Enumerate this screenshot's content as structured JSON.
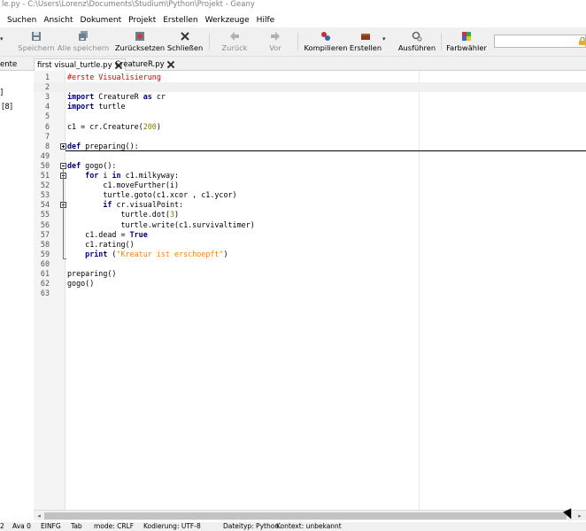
{
  "window": {
    "title": "le.py - C:\\Users\\Lorenz\\Documents\\Studium\\Python\\Projekt - Geany"
  },
  "menu": [
    "Suchen",
    "Ansicht",
    "Dokument",
    "Projekt",
    "Erstellen",
    "Werkzeuge",
    "Hilfe"
  ],
  "toolbar": {
    "save_label": "Speichern",
    "save_all_label": "Alle speichern",
    "revert_label": "Zurücksetzen",
    "close_label": "Schließen",
    "back_label": "Zurück",
    "forward_label": "Vor",
    "compile_label": "Kompilieren",
    "build_label": "Erstellen",
    "run_label": "Ausführen",
    "color_label": "Farbwähler",
    "dropdown_glyph": "▾"
  },
  "sidebar": {
    "tab_label": "ente",
    "items": [
      "]",
      "[8]"
    ]
  },
  "tabs": [
    {
      "label": "first visual_turtle.py",
      "active": true
    },
    {
      "label": "CreatureR.py",
      "active": false
    }
  ],
  "editor": {
    "lines": [
      {
        "n": "1",
        "code": "#erste Visualisierung"
      },
      {
        "n": "2",
        "code": ""
      },
      {
        "n": "3",
        "code": "import CreatureR as cr"
      },
      {
        "n": "4",
        "code": "import turtle"
      },
      {
        "n": "5",
        "code": ""
      },
      {
        "n": "6",
        "code": "c1 = cr.Creature(200)"
      },
      {
        "n": "7",
        "code": ""
      },
      {
        "n": "8",
        "code": "def preparing():"
      },
      {
        "n": "49",
        "code": ""
      },
      {
        "n": "50",
        "code": "def gogo():"
      },
      {
        "n": "51",
        "code": "    for i in c1.milkyway:"
      },
      {
        "n": "52",
        "code": "        c1.moveFurther(i)"
      },
      {
        "n": "53",
        "code": "        turtle.goto(c1.xcor , c1.ycor)"
      },
      {
        "n": "54",
        "code": "        if cr.visualPoint:"
      },
      {
        "n": "55",
        "code": "            turtle.dot(3)"
      },
      {
        "n": "56",
        "code": "            turtle.write(c1.survivaltimer)"
      },
      {
        "n": "57",
        "code": "    c1.dead = True"
      },
      {
        "n": "58",
        "code": "    c1.rating()"
      },
      {
        "n": "59",
        "code": "    print (\"Kreatur ist erschoepft\")"
      },
      {
        "n": "60",
        "code": ""
      },
      {
        "n": "61",
        "code": "preparing()"
      },
      {
        "n": "62",
        "code": "gogo()"
      },
      {
        "n": "63",
        "code": ""
      }
    ]
  },
  "statusbar": {
    "line": "2",
    "col": "Ava 0",
    "mode1": "EINFG",
    "mode2": "Tab",
    "eol": "mode: CRLF",
    "encoding": "Kodierung: UTF-8",
    "filetype": "Dateityp: Python",
    "context": "Kontext: unbekannt"
  },
  "colors": {
    "keyword": "#00007f",
    "comment": "#d00000",
    "string": "#ff8000",
    "number": "#7f7f00"
  }
}
